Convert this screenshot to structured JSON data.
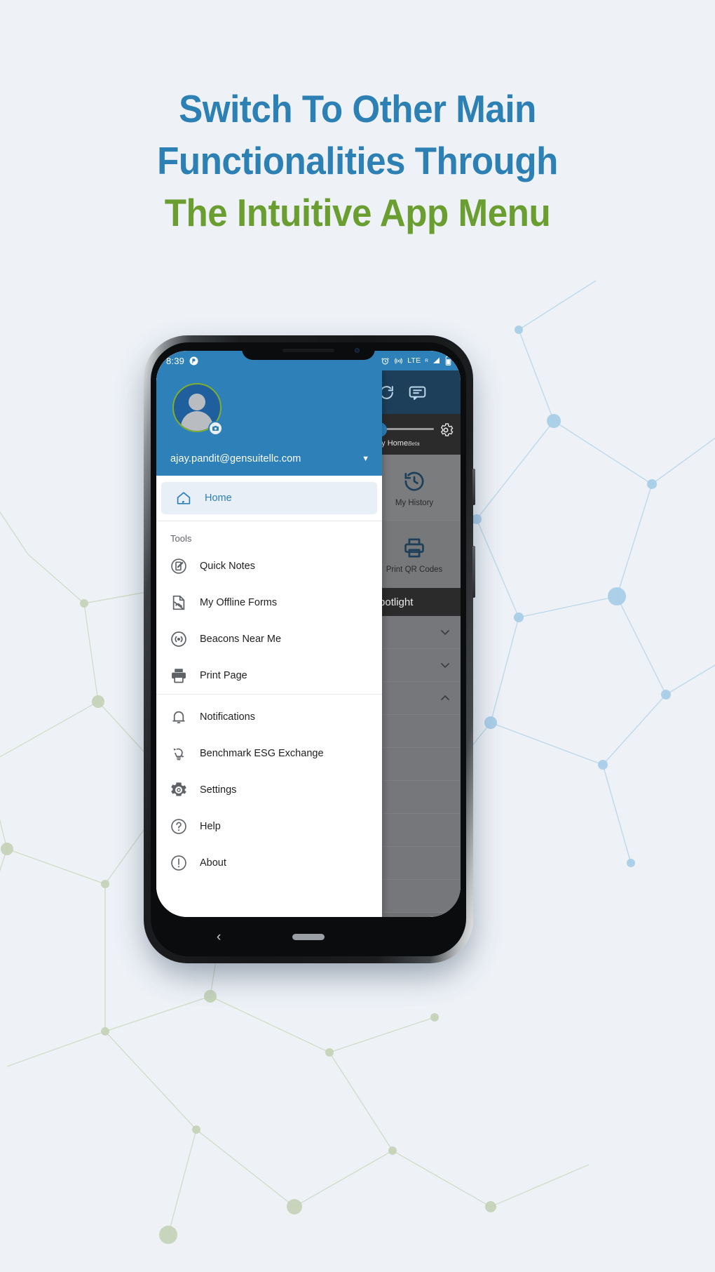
{
  "headline": {
    "line1": "Switch To Other Main",
    "line2": "Functionalities Through",
    "line3": "The Intuitive App Menu",
    "color_blue": "#2c80b4",
    "color_green": "#6a9e30"
  },
  "phone": {
    "status_bar": {
      "time": "8:39",
      "left_icons": [
        "do-not-disturb-icon"
      ],
      "network_label": "LTE",
      "network_superscript": "R",
      "right_icons": [
        "alarm-icon",
        "hotspot-icon",
        "signal-icon",
        "battery-icon"
      ]
    },
    "nav_bar": {
      "back_glyph": "‹",
      "icons": [
        "back-icon",
        "home-pill-icon"
      ]
    }
  },
  "drawer": {
    "account": {
      "email": "ajay.pandit@gensuitellc.com",
      "caret": "▼",
      "avatar_icon": "person-avatar-icon",
      "camera_badge_icon": "camera-icon"
    },
    "home_item": {
      "label": "Home",
      "icon": "home-icon"
    },
    "tools_section_title": "Tools",
    "tools": [
      {
        "label": "Quick Notes",
        "icon": "quick-notes-icon"
      },
      {
        "label": "My Offline Forms",
        "icon": "offline-forms-icon"
      },
      {
        "label": "Beacons Near Me",
        "icon": "beacon-icon"
      },
      {
        "label": "Print Page",
        "icon": "printer-icon"
      }
    ],
    "general": [
      {
        "label": "Notifications",
        "icon": "bell-icon"
      },
      {
        "label": "Benchmark ESG Exchange",
        "icon": "esg-exchange-icon"
      },
      {
        "label": "Settings",
        "icon": "gear-icon"
      },
      {
        "label": "Help",
        "icon": "help-icon"
      },
      {
        "label": "About",
        "icon": "info-icon"
      }
    ]
  },
  "background_screen": {
    "toolbar_icons": [
      "refresh-icon",
      "chat-icon"
    ],
    "slider_label": "My Home",
    "slider_badge": "Beta",
    "settings_icon": "gear-icon",
    "tiles": [
      {
        "label": "My History",
        "icon": "history-icon"
      },
      {
        "label": "Print QR Codes",
        "icon": "printer-icon"
      }
    ],
    "spotlight_title": "Spotlight",
    "collapse_rows": [
      {
        "chevron": "⌄"
      },
      {
        "chevron": "⌄"
      },
      {
        "chevron": "⌃"
      }
    ]
  },
  "colors": {
    "page_background": "#eef2f7",
    "app_accent_blue": "#2d80b8",
    "avatar_ring_green": "#7fae2f",
    "active_item_bg": "#e8eff7"
  }
}
